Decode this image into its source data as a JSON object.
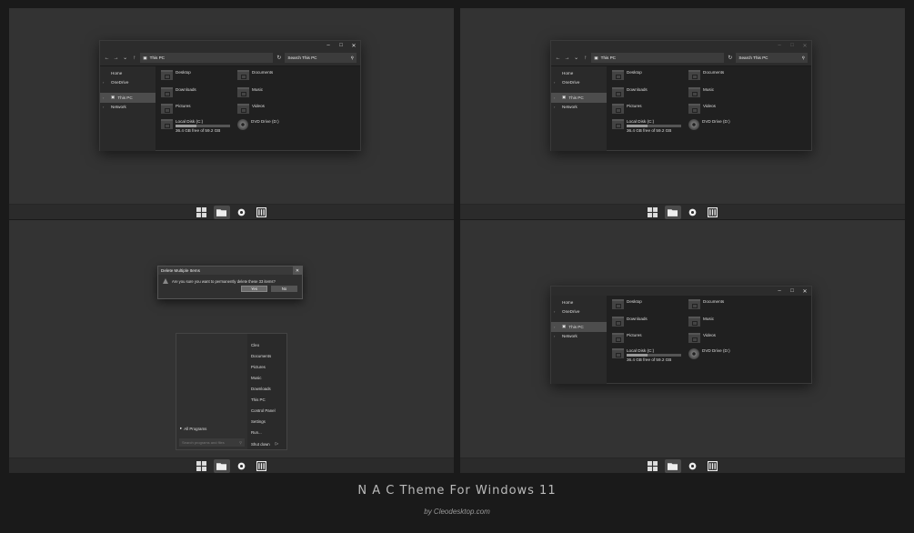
{
  "caption": {
    "title": "N A C Theme For Windows 11",
    "byline": "by Cleodesktop.com"
  },
  "explorer": {
    "address": "This PC",
    "search_placeholder": "Search This PC",
    "sidebar": [
      "Home",
      "OneDrive",
      "This PC",
      "Network"
    ],
    "folders": [
      "Desktop",
      "Documents",
      "Downloads",
      "Music",
      "Pictures",
      "Videos"
    ],
    "drive_c": {
      "name": "Local Disk (C:)",
      "free": "36.4 GB free of 59.2 GB",
      "used_fraction": 0.39
    },
    "drive_d": {
      "name": "DVD Drive (D:)"
    }
  },
  "dialog": {
    "title": "Delete Multiple Items",
    "message": "Are you sure you want to permanently delete these 33 items?",
    "yes": "Yes",
    "no": "No"
  },
  "start_menu": {
    "items": [
      "Cleo",
      "Documents",
      "Pictures",
      "Music",
      "Downloads",
      "This PC",
      "Control Panel",
      "Settings",
      "Run..."
    ],
    "all_programs": "All Programs",
    "search_placeholder": "Search programs and files",
    "shutdown": "Shut down"
  },
  "taskbar": {
    "icons": [
      "start-icon",
      "file-explorer-icon",
      "settings-icon",
      "control-panel-icon"
    ]
  }
}
